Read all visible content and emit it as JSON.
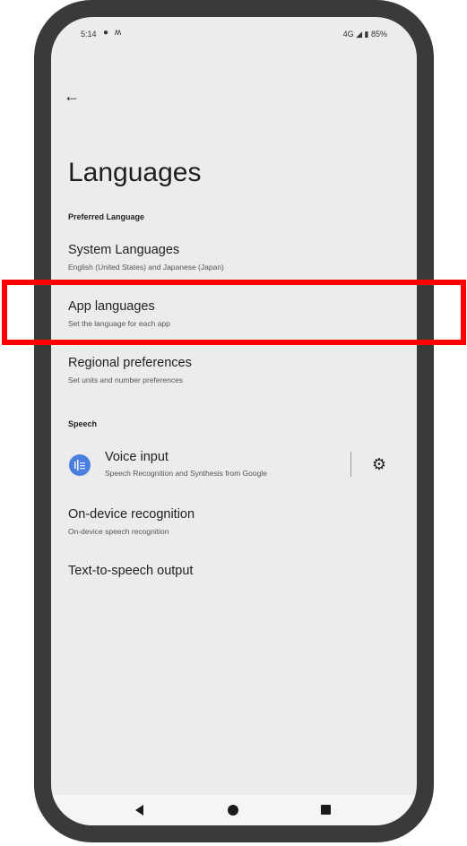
{
  "status_bar": {
    "time": "5:14",
    "left_icons": "messaging-icon, wave-icon",
    "left_glyphs": "● ʍ",
    "right_text": "4G ◢ ▮ 85%"
  },
  "header": {
    "title": "Languages"
  },
  "sections": [
    {
      "header": "Preferred Language",
      "items": [
        {
          "title": "System Languages",
          "subtitle": "English (United States) and Japanese (Japan)"
        },
        {
          "title": "App languages",
          "subtitle": "Set the language for each app"
        },
        {
          "title": "Regional preferences",
          "subtitle": "Set units and number preferences"
        }
      ]
    },
    {
      "header": "Speech",
      "items": [
        {
          "title": "Voice input",
          "subtitle": "Speech Recognition and Synthesis from Google",
          "icon": "google-voice-icon",
          "secondary_icon": "gear-icon"
        },
        {
          "title": "On-device recognition",
          "subtitle": "On-device speech recognition"
        },
        {
          "title": "Text-to-speech output"
        }
      ]
    }
  ],
  "nav_bar": {
    "buttons": [
      "back",
      "home",
      "recents"
    ]
  },
  "annotation": {
    "highlight_color": "#ff0000",
    "highlighted_item": "App languages"
  }
}
